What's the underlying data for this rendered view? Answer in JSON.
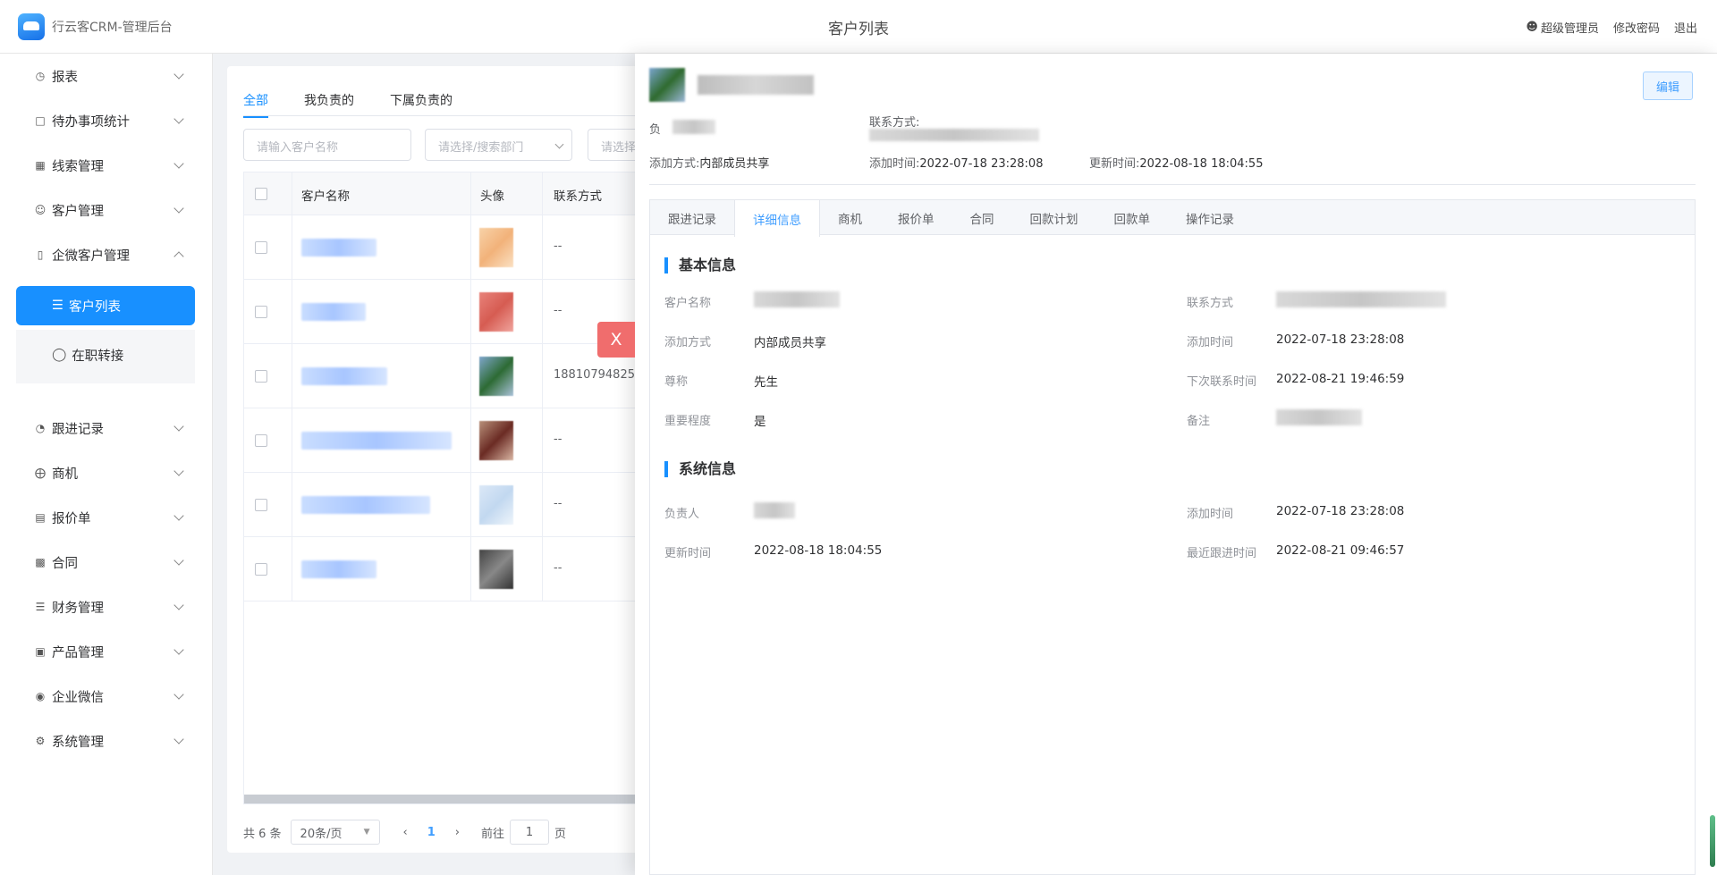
{
  "header": {
    "app_title": "行云客CRM-管理后台",
    "page_title": "客户列表",
    "user": "超级管理员",
    "change_password": "修改密码",
    "logout": "退出"
  },
  "sidebar": {
    "items": [
      {
        "label": "报表",
        "icon": "report-icon"
      },
      {
        "label": "待办事项统计",
        "icon": "todo-icon"
      },
      {
        "label": "线索管理",
        "icon": "lead-icon"
      },
      {
        "label": "客户管理",
        "icon": "user-icon"
      },
      {
        "label": "企微客户管理",
        "icon": "wechat-customer-icon"
      },
      {
        "label": "跟进记录",
        "icon": "followup-icon"
      },
      {
        "label": "商机",
        "icon": "opportunity-icon"
      },
      {
        "label": "报价单",
        "icon": "quote-icon"
      },
      {
        "label": "合同",
        "icon": "contract-icon"
      },
      {
        "label": "财务管理",
        "icon": "finance-icon"
      },
      {
        "label": "产品管理",
        "icon": "product-icon"
      },
      {
        "label": "企业微信",
        "icon": "wechat-icon"
      },
      {
        "label": "系统管理",
        "icon": "settings-icon"
      }
    ],
    "sub_active": "客户列表",
    "sub_item": "在职转接"
  },
  "list": {
    "tabs": [
      "全部",
      "我负责的",
      "下属负责的"
    ],
    "filters": {
      "name_placeholder": "请输入客户名称",
      "dept_placeholder": "请选择/搜索部门",
      "other_placeholder": "请选择"
    },
    "columns": [
      "客户名称",
      "头像",
      "联系方式"
    ],
    "rows": [
      {
        "contact": "--"
      },
      {
        "contact": "--"
      },
      {
        "contact": "18810794825"
      },
      {
        "contact": "--"
      },
      {
        "contact": "--"
      },
      {
        "contact": "--"
      }
    ],
    "pager": {
      "total": "共 6 条",
      "size": "20条/页",
      "page": "1",
      "goto": "前往",
      "goto_value": "1",
      "page_suffix": "页"
    }
  },
  "drawer": {
    "close": "X",
    "edit": "编辑",
    "meta": {
      "owner_label": "负",
      "contact_label": "联系方式:",
      "add_method_label": "添加方式:",
      "add_method": "内部成员共享",
      "add_time_label": "添加时间:",
      "add_time": "2022-07-18 23:28:08",
      "update_time_label": "更新时间:",
      "update_time": "2022-08-18 18:04:55"
    },
    "tabs": [
      "跟进记录",
      "详细信息",
      "商机",
      "报价单",
      "合同",
      "回款计划",
      "回款单",
      "操作记录"
    ],
    "basic": {
      "title": "基本信息",
      "name_label": "客户名称",
      "contact_label": "联系方式",
      "add_method_label": "添加方式",
      "add_method": "内部成员共享",
      "add_time_label": "添加时间",
      "add_time": "2022-07-18 23:28:08",
      "title_label": "尊称",
      "title_value": "先生",
      "next_contact_label": "下次联系时间",
      "next_contact": "2022-08-21 19:46:59",
      "importance_label": "重要程度",
      "importance": "是",
      "remark_label": "备注"
    },
    "system": {
      "title": "系统信息",
      "owner_label": "负责人",
      "add_time_label": "添加时间",
      "add_time": "2022-07-18 23:28:08",
      "update_time_label": "更新时间",
      "update_time": "2022-08-18 18:04:55",
      "last_follow_label": "最近跟进时间",
      "last_follow": "2022-08-21 09:46:57"
    }
  }
}
